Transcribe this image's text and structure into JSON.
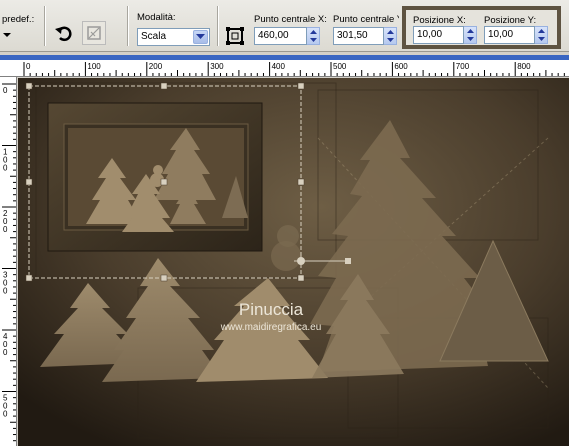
{
  "toolbar": {
    "preset_label": "predef.:",
    "mode_label": "Modalità:",
    "mode_value": "Scala",
    "center_x_label": "Punto centrale X:",
    "center_x_value": "460,00",
    "center_y_label": "Punto centrale Y:",
    "center_y_value": "301,50",
    "pos_x_label": "Posizione X:",
    "pos_x_value": "10,00",
    "pos_y_label": "Posizione Y:",
    "pos_y_value": "10,00",
    "highlight_color": "#5e5341"
  },
  "ruler": {
    "top": [
      "0",
      "100",
      "200",
      "300",
      "400",
      "500",
      "600",
      "700",
      "800"
    ],
    "left": [
      "0",
      "100",
      "200",
      "300",
      "400",
      "500"
    ]
  },
  "canvas": {
    "watermark_title": "Pinuccia",
    "watermark_url": "www.maidiregrafica.eu",
    "background_color": "#3b3124"
  }
}
